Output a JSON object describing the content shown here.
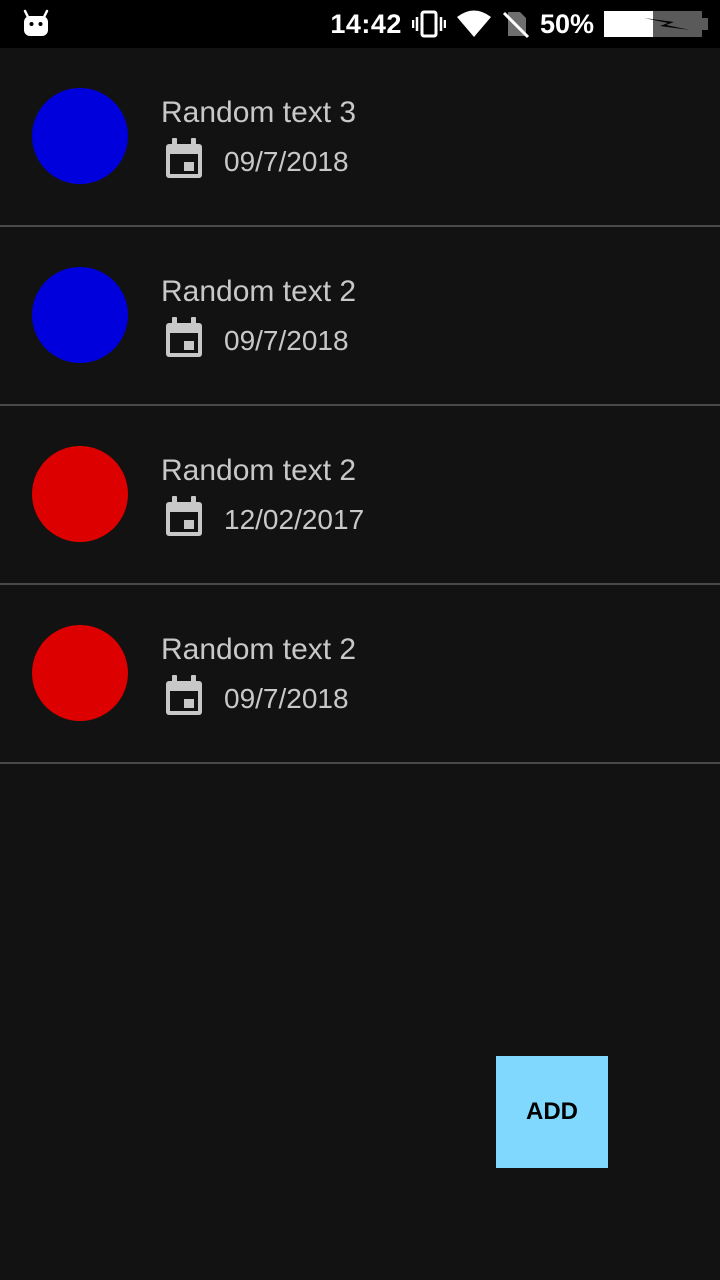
{
  "status_bar": {
    "time": "14:42",
    "battery_percent": "50%",
    "icons": [
      "android-debug-icon",
      "vibrate-icon",
      "wifi-icon",
      "no-sim-icon",
      "battery-charging-icon"
    ]
  },
  "items": [
    {
      "title": "Random text 3",
      "date": "09/7/2018",
      "color": "#0000dd",
      "icon": "calendar-icon"
    },
    {
      "title": "Random text 2",
      "date": "09/7/2018",
      "color": "#0000dd",
      "icon": "calendar-icon"
    },
    {
      "title": "Random text 2",
      "date": "12/02/2017",
      "color": "#dd0000",
      "icon": "calendar-icon"
    },
    {
      "title": "Random text 2",
      "date": "09/7/2018",
      "color": "#dd0000",
      "icon": "calendar-icon"
    }
  ],
  "add_button": {
    "label": "ADD",
    "color": "#80d8ff"
  }
}
